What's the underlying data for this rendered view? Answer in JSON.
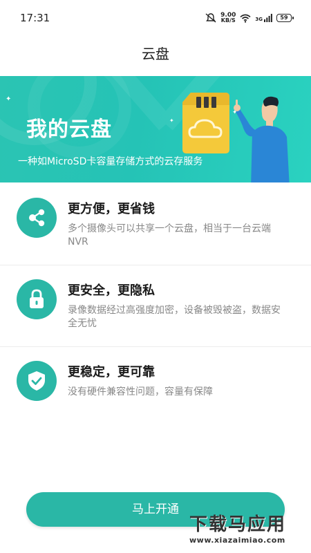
{
  "status_bar": {
    "time": "17:31",
    "net_speed_value": "9.00",
    "net_speed_unit": "KB/S",
    "network": "3G",
    "battery": "59"
  },
  "header": {
    "title": "云盘"
  },
  "banner": {
    "heading": "我的云盘",
    "subtitle": "一种如MicroSD卡容量存储方式的云存服务"
  },
  "features": [
    {
      "icon": "share-icon",
      "title": "更方便，更省钱",
      "description": "多个摄像头可以共享一个云盘，相当于一台云端NVR"
    },
    {
      "icon": "lock-icon",
      "title": "更安全，更隐私",
      "description": "录像数据经过高强度加密，设备被毁被盗，数据安全无忧"
    },
    {
      "icon": "shield-check-icon",
      "title": "更稳定，更可靠",
      "description": "没有硬件兼容性问题，容量有保障"
    }
  ],
  "cta": {
    "label": "马上开通"
  },
  "watermark": {
    "brand": "下载马应用",
    "url": "www.xiazaimiao.com"
  },
  "colors": {
    "accent": "#2ab7a6",
    "banner": "#25c3b6"
  }
}
